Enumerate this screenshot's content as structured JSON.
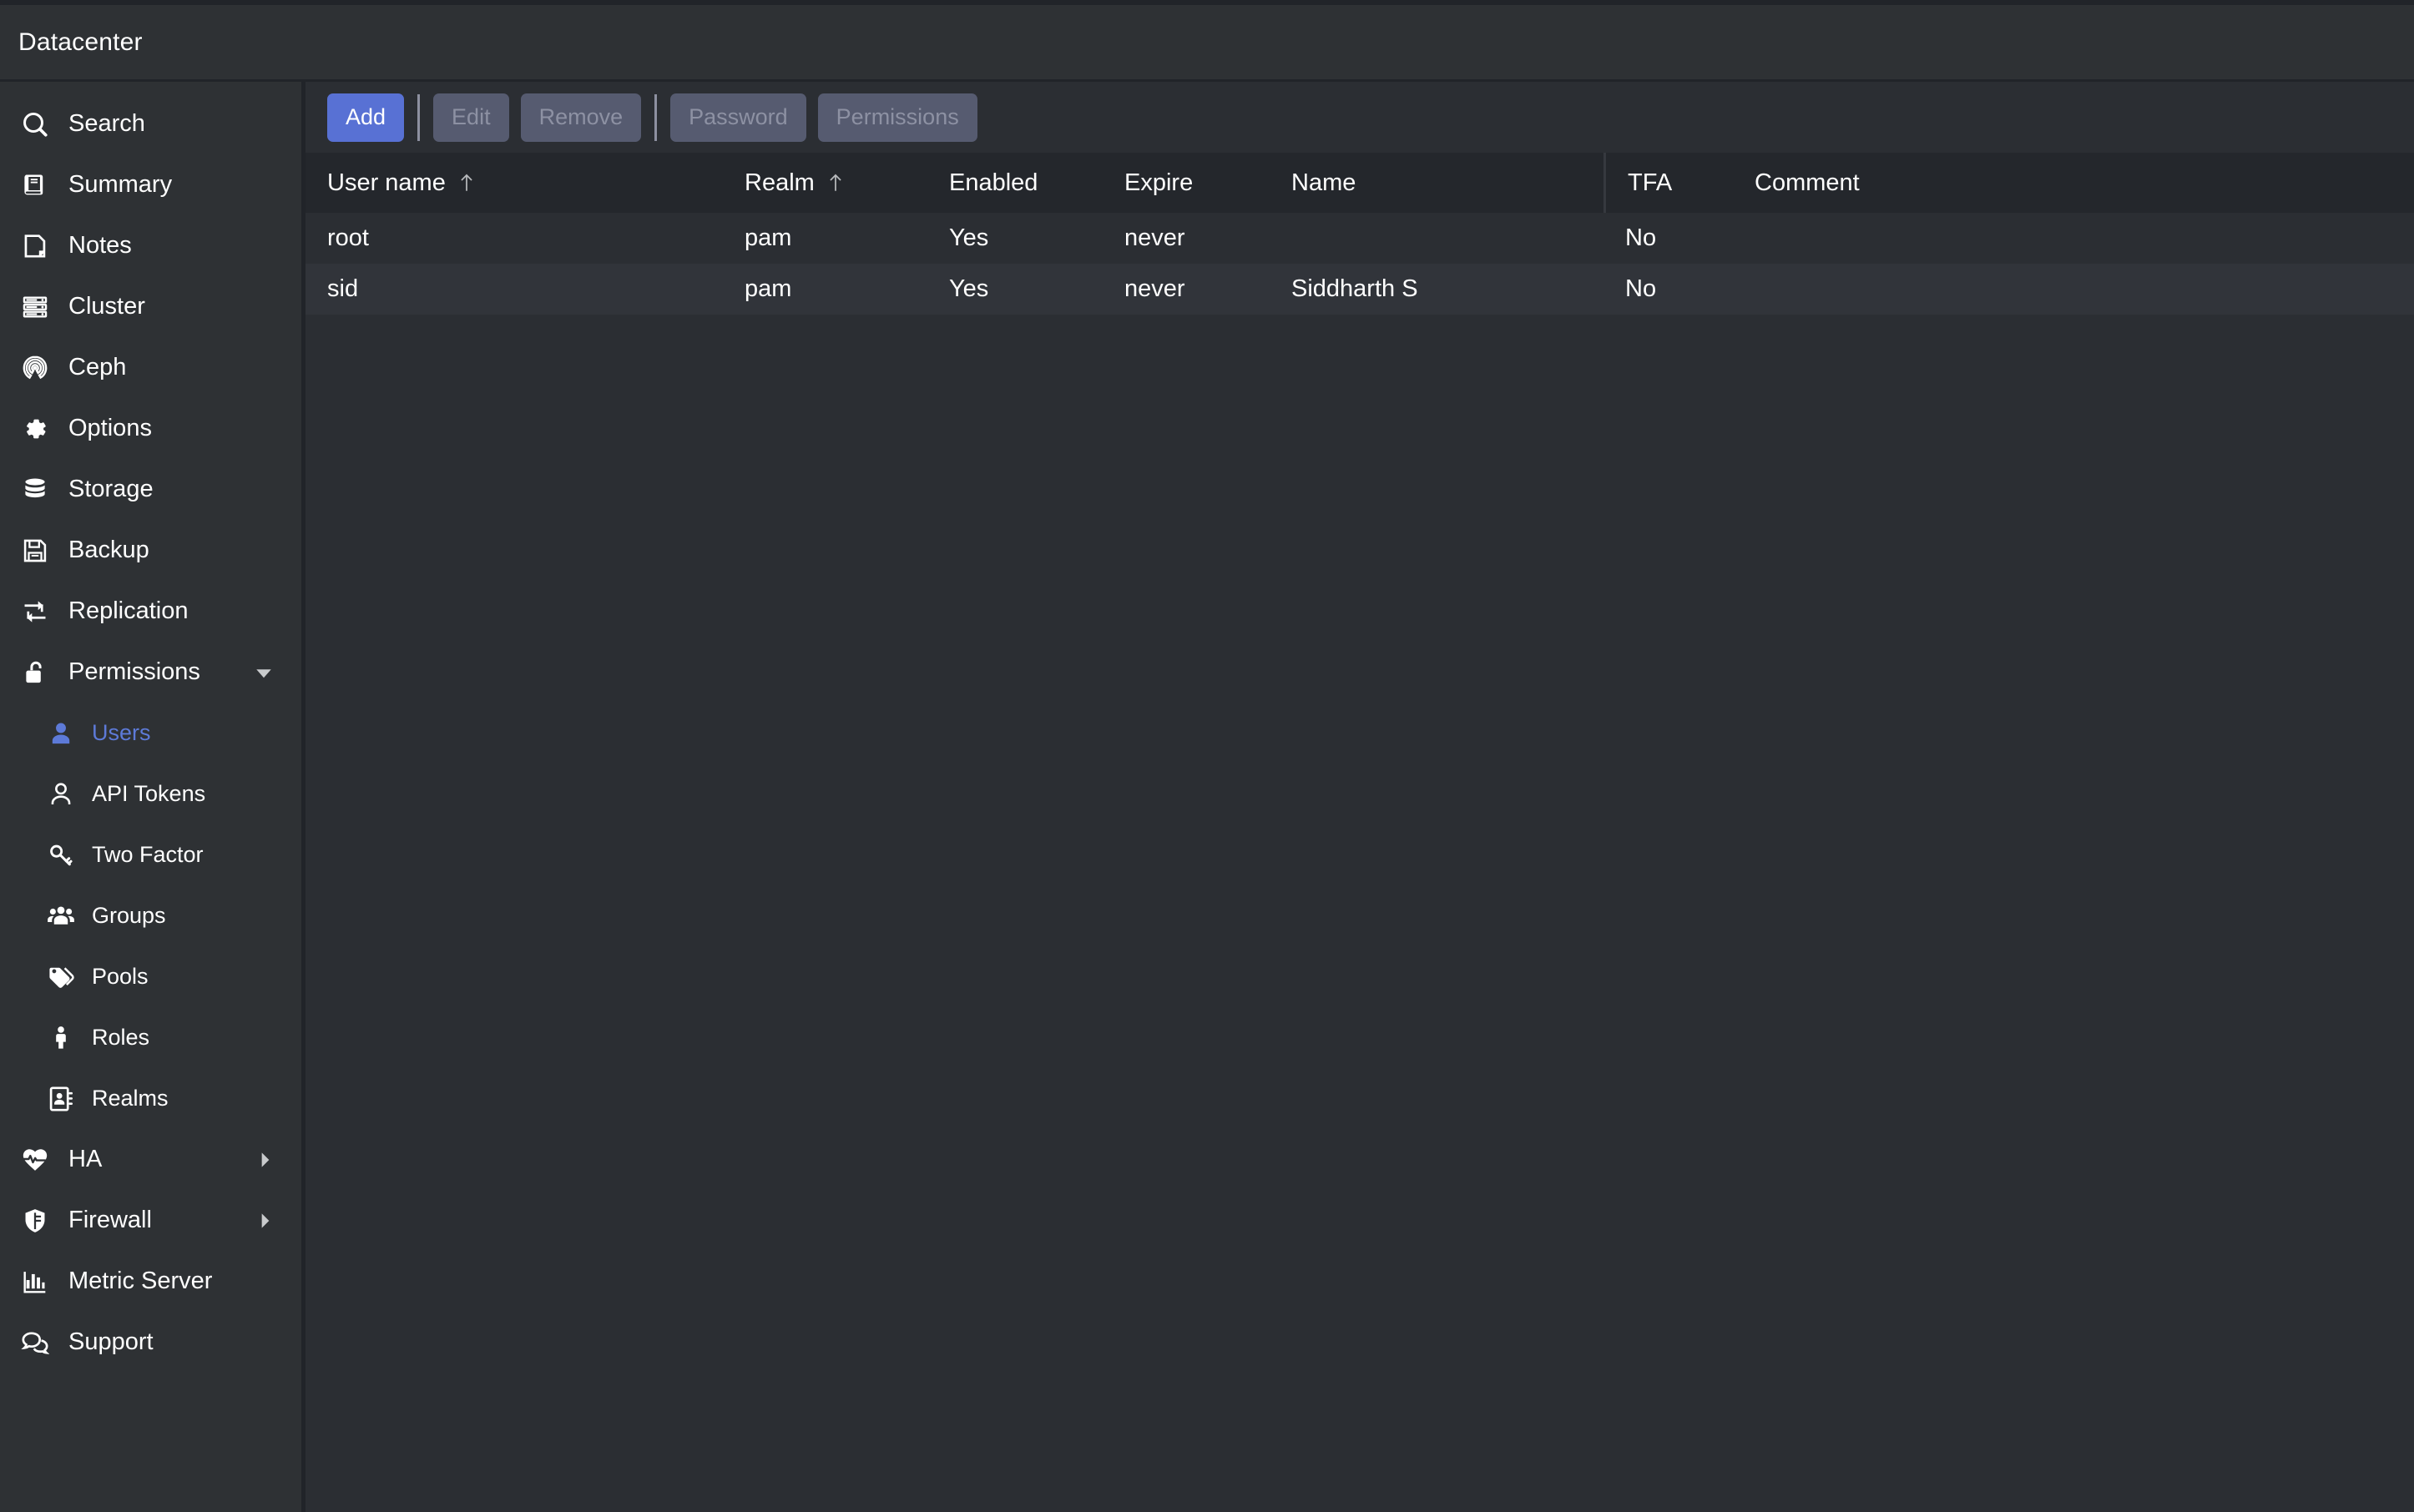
{
  "window": {
    "title": "Datacenter"
  },
  "sidebar": {
    "items": [
      {
        "label": "Search",
        "icon": "search-icon",
        "level": "top"
      },
      {
        "label": "Summary",
        "icon": "book-icon",
        "level": "top"
      },
      {
        "label": "Notes",
        "icon": "note-icon",
        "level": "top"
      },
      {
        "label": "Cluster",
        "icon": "server-rack-icon",
        "level": "top"
      },
      {
        "label": "Ceph",
        "icon": "ceph-icon",
        "level": "top"
      },
      {
        "label": "Options",
        "icon": "gear-icon",
        "level": "top"
      },
      {
        "label": "Storage",
        "icon": "database-icon",
        "level": "top"
      },
      {
        "label": "Backup",
        "icon": "floppy-disk-icon",
        "level": "top"
      },
      {
        "label": "Replication",
        "icon": "replication-icon",
        "level": "top"
      },
      {
        "label": "Permissions",
        "icon": "unlock-icon",
        "level": "top",
        "expanded": true,
        "chevron": "chevron-down-icon"
      },
      {
        "label": "Users",
        "icon": "user-filled-icon",
        "level": "sub",
        "active": true
      },
      {
        "label": "API Tokens",
        "icon": "user-outline-icon",
        "level": "sub"
      },
      {
        "label": "Two Factor",
        "icon": "key-icon",
        "level": "sub"
      },
      {
        "label": "Groups",
        "icon": "users-group-icon",
        "level": "sub"
      },
      {
        "label": "Pools",
        "icon": "tags-icon",
        "level": "sub"
      },
      {
        "label": "Roles",
        "icon": "person-icon",
        "level": "sub"
      },
      {
        "label": "Realms",
        "icon": "address-book-icon",
        "level": "sub"
      },
      {
        "label": "HA",
        "icon": "heartbeat-icon",
        "level": "top",
        "chevron": "chevron-right-icon"
      },
      {
        "label": "Firewall",
        "icon": "shield-icon",
        "level": "top",
        "chevron": "chevron-right-icon"
      },
      {
        "label": "Metric Server",
        "icon": "bar-chart-icon",
        "level": "top"
      },
      {
        "label": "Support",
        "icon": "comments-icon",
        "level": "top"
      }
    ]
  },
  "toolbar": {
    "buttons": [
      {
        "label": "Add",
        "state": "enabled"
      },
      {
        "label": "Edit",
        "state": "disabled"
      },
      {
        "label": "Remove",
        "state": "disabled"
      },
      {
        "label": "Password",
        "state": "disabled"
      },
      {
        "label": "Permissions",
        "state": "disabled"
      }
    ]
  },
  "table": {
    "columns": [
      {
        "key": "username",
        "label": "User name",
        "sort": "asc"
      },
      {
        "key": "realm",
        "label": "Realm",
        "sort": "asc"
      },
      {
        "key": "enabled",
        "label": "Enabled",
        "sort": null
      },
      {
        "key": "expire",
        "label": "Expire",
        "sort": null
      },
      {
        "key": "name",
        "label": "Name",
        "sort": null
      },
      {
        "key": "tfa",
        "label": "TFA",
        "sort": null
      },
      {
        "key": "comment",
        "label": "Comment",
        "sort": null
      }
    ],
    "rows": [
      {
        "username": "root",
        "realm": "pam",
        "enabled": "Yes",
        "expire": "never",
        "name": "",
        "tfa": "No",
        "comment": ""
      },
      {
        "username": "sid",
        "realm": "pam",
        "enabled": "Yes",
        "expire": "never",
        "name": "Siddharth S",
        "tfa": "No",
        "comment": ""
      }
    ]
  },
  "colors": {
    "accent": "#5871d4",
    "active_text": "#5d7ad8",
    "sidebar_bg": "#2e3134",
    "content_bg": "#2b2e33",
    "header_bg": "#24272c",
    "row_alt_bg": "#31343a",
    "disabled_btn_bg": "#565b70",
    "disabled_btn_text": "#8d91a3"
  }
}
